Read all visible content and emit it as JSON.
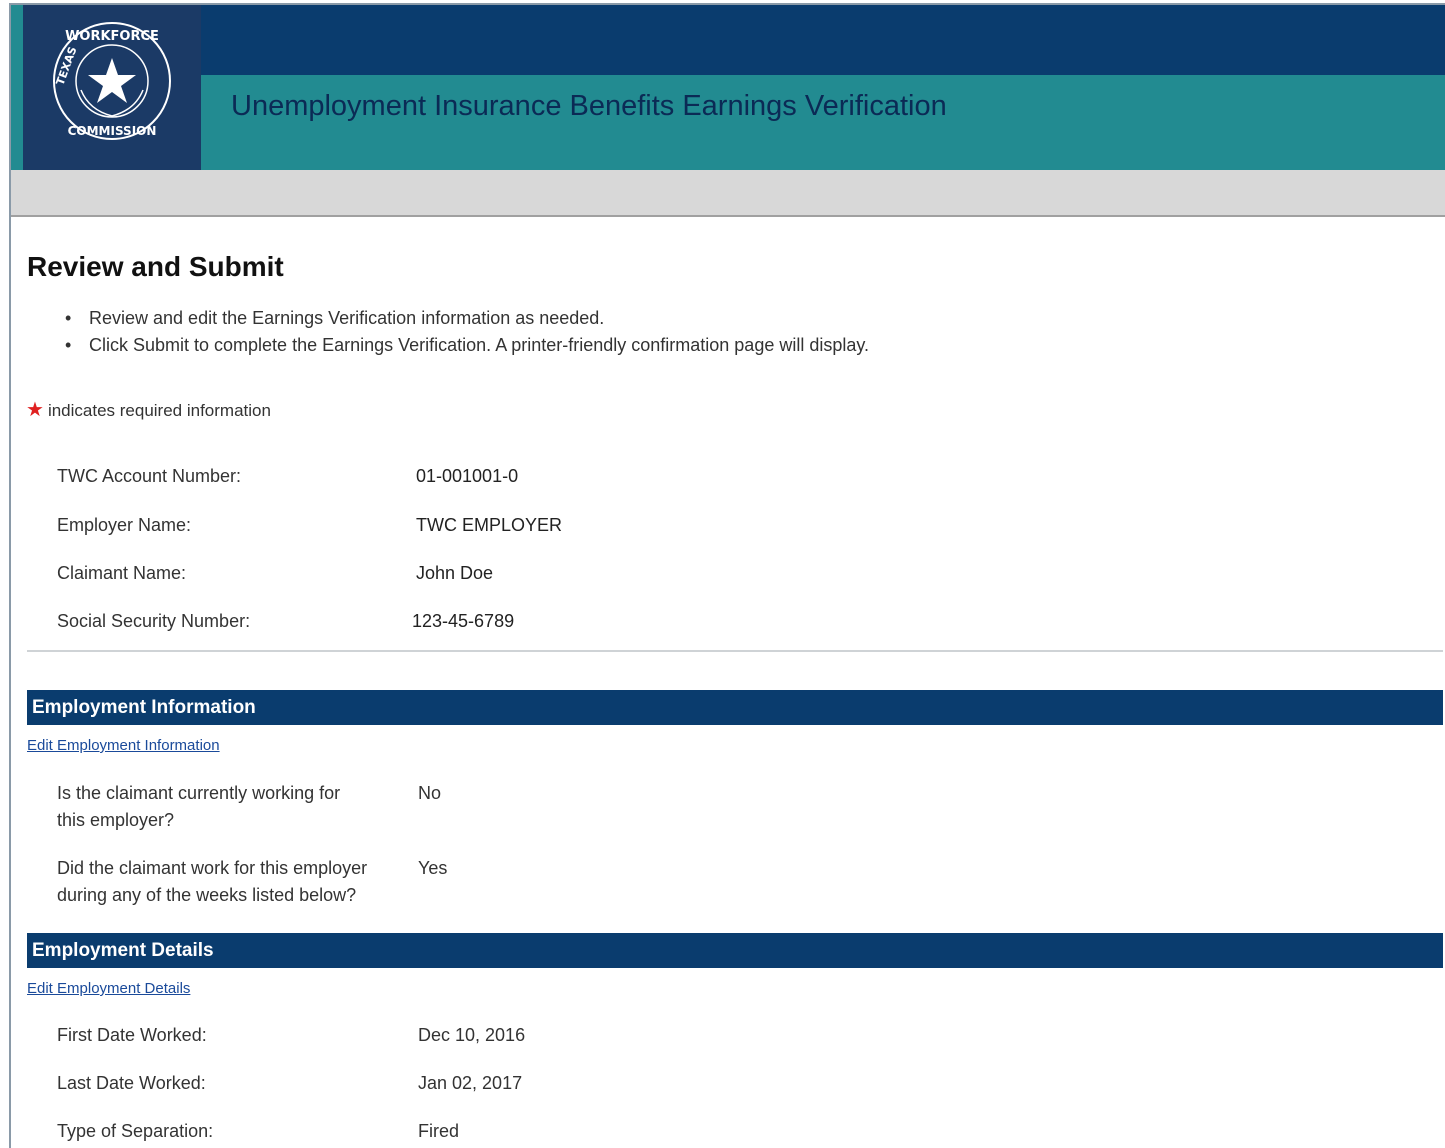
{
  "header": {
    "title": "Unemployment Insurance Benefits Earnings Verification",
    "logo_text": "TEXAS WORKFORCE COMMISSION"
  },
  "page": {
    "title": "Review and Submit",
    "bullets": [
      "Review and edit the Earnings Verification information as needed.",
      "Click Submit to complete the Earnings Verification. A printer-friendly confirmation page will display."
    ],
    "required_note": "indicates required information"
  },
  "summary": [
    {
      "label": "TWC Account Number:",
      "value": "01-001001-0"
    },
    {
      "label": "Employer Name:",
      "value": "TWC EMPLOYER"
    },
    {
      "label": "Claimant Name:",
      "value": "John Doe"
    },
    {
      "label": "Social Security Number:",
      "value": "123-45-6789"
    }
  ],
  "employment_information": {
    "heading": "Employment Information",
    "edit_link": "Edit Employment Information",
    "items": [
      {
        "question_line1": "Is the claimant currently working for",
        "question_line2": "this employer?",
        "answer": "No"
      },
      {
        "question_line1": "Did the claimant work for this employer",
        "question_line2": "during any of the weeks listed below?",
        "answer": "Yes"
      }
    ]
  },
  "employment_details": {
    "heading": "Employment Details",
    "edit_link": "Edit Employment Details",
    "items": [
      {
        "label": "First Date Worked:",
        "value": "Dec 10, 2016"
      },
      {
        "label": "Last Date Worked:",
        "value": "Jan 02, 2017"
      },
      {
        "label": "Type of Separation:",
        "value": "Fired"
      }
    ]
  },
  "colors": {
    "navy": "#0a3c6e",
    "teal": "#228b91",
    "required_star": "#e02020",
    "link": "#1a4a9a"
  }
}
